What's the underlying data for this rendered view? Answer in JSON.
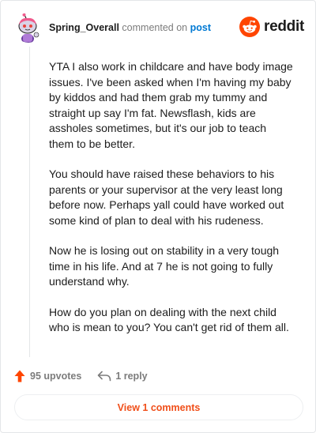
{
  "comment": {
    "username": "Spring_Overall",
    "commented_text": "commented on",
    "post_link_text": "post",
    "paragraphs": [
      "YTA I also work in childcare and have body image issues. I've been asked when I'm having my baby by kiddos and had them grab my tummy and straight up say I'm fat. Newsflash, kids are assholes sometimes, but it's our job to teach them to be better.",
      "You should have raised these behaviors to his parents or your supervisor at the very least long before now. Perhaps yall could have worked out some kind of plan to deal with his rudeness.",
      "Now he is losing out on stability in a very tough time in his life. And at 7 he is not going to fully understand why.",
      "How do you plan on dealing with the next child who is mean to you? You can't get rid of them all."
    ]
  },
  "brand": {
    "wordmark": "reddit",
    "icon": "reddit-alien-icon",
    "color": "#ff4500"
  },
  "actions": {
    "upvotes_label": "95 upvotes",
    "upvote_icon": "upvote-arrow-icon",
    "upvote_color": "#ff4500",
    "reply_label": "1 reply",
    "reply_icon": "reply-arrow-icon"
  },
  "footer": {
    "view_comments_label": "View 1 comments",
    "accent_color": "#f04f1a"
  }
}
